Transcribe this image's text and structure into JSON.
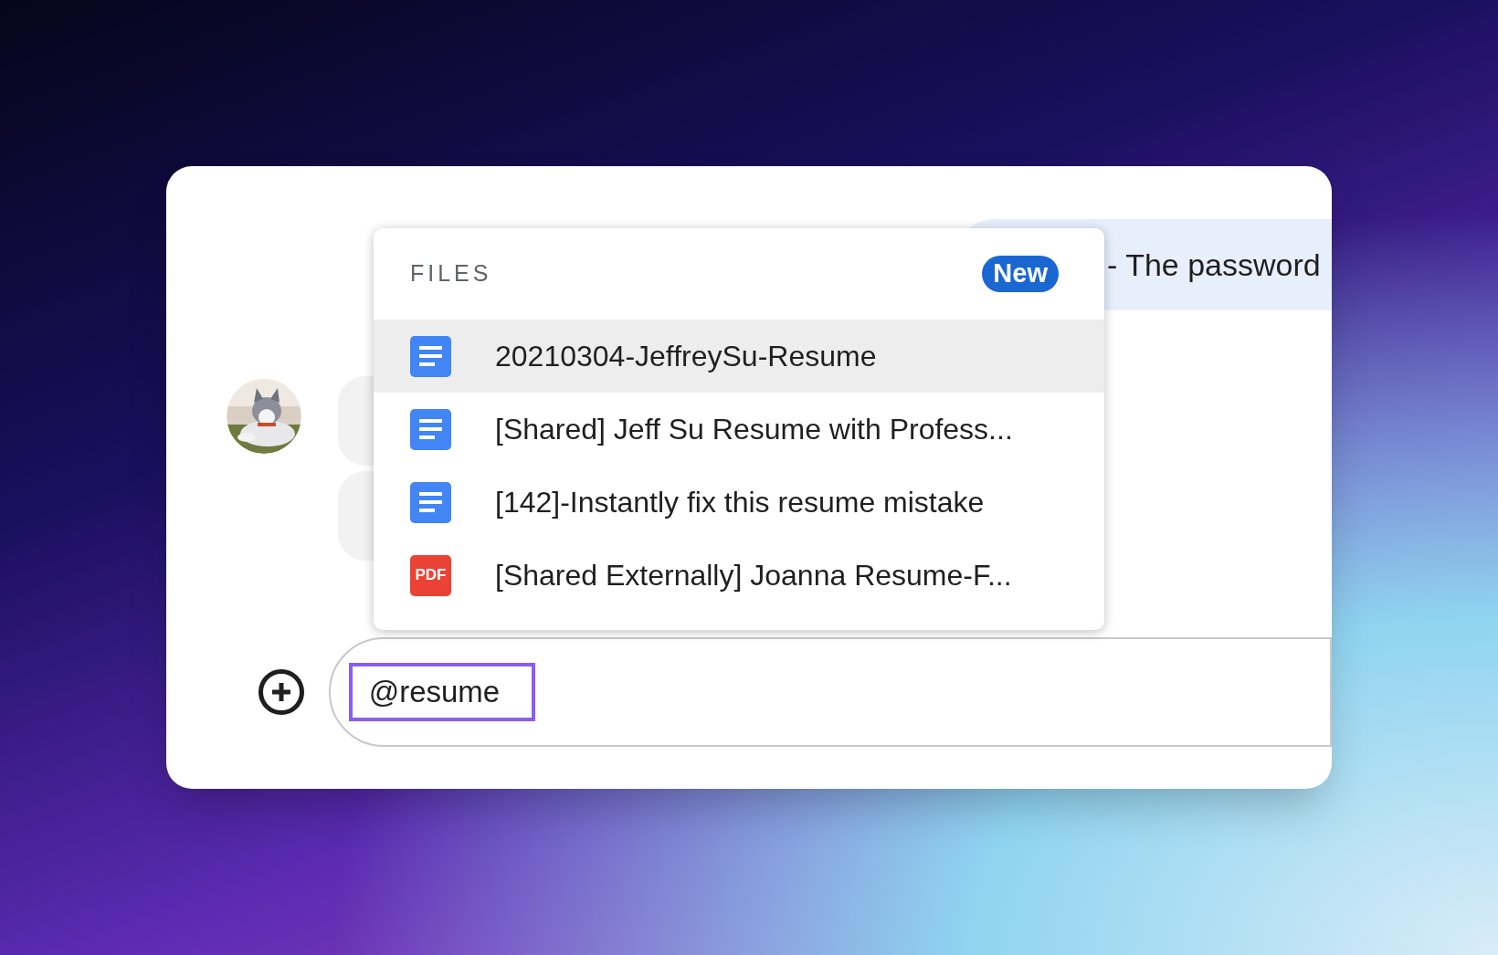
{
  "messages_behind": {
    "right_bubble": "- The password"
  },
  "files_menu": {
    "heading": "FILES",
    "badge": "New",
    "items": [
      {
        "kind": "doc",
        "name": "20210304-JeffreySu-Resume",
        "selected": true
      },
      {
        "kind": "doc",
        "name": "[Shared] Jeff Su Resume with Profess...",
        "selected": false
      },
      {
        "kind": "doc",
        "name": "[142]-Instantly fix this resume mistake",
        "selected": false
      },
      {
        "kind": "pdf",
        "name": "[Shared Externally] Joanna Resume-F...",
        "selected": false,
        "icon_text": "PDF"
      }
    ]
  },
  "composer": {
    "value": "@resume"
  }
}
